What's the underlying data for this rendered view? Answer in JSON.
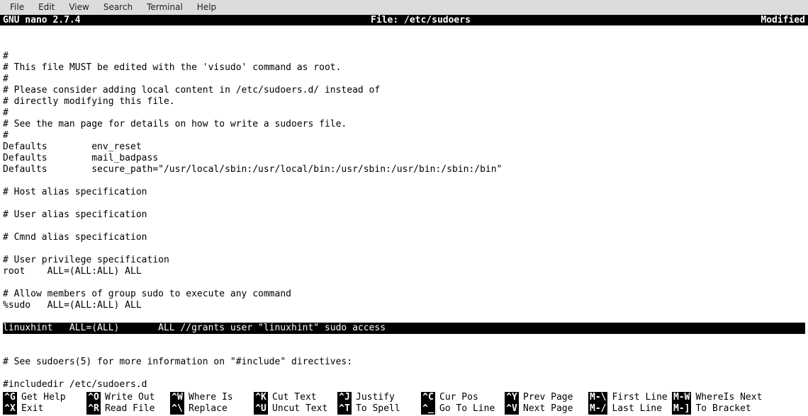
{
  "menubar": {
    "items": [
      "File",
      "Edit",
      "View",
      "Search",
      "Terminal",
      "Help"
    ]
  },
  "nano_title": {
    "app": "GNU nano 2.7.4",
    "file_label": "File: /etc/sudoers",
    "status": "Modified"
  },
  "content_lines": [
    "",
    "",
    "#",
    "# This file MUST be edited with the 'visudo' command as root.",
    "#",
    "# Please consider adding local content in /etc/sudoers.d/ instead of",
    "# directly modifying this file.",
    "#",
    "# See the man page for details on how to write a sudoers file.",
    "#",
    "Defaults        env_reset",
    "Defaults        mail_badpass",
    "Defaults        secure_path=\"/usr/local/sbin:/usr/local/bin:/usr/sbin:/usr/bin:/sbin:/bin\"",
    "",
    "# Host alias specification",
    "",
    "# User alias specification",
    "",
    "# Cmnd alias specification",
    "",
    "# User privilege specification",
    "root    ALL=(ALL:ALL) ALL",
    "",
    "# Allow members of group sudo to execute any command",
    "%sudo   ALL=(ALL:ALL) ALL",
    ""
  ],
  "cursor_line": "linuxhint   ALL=(ALL)       ALL //grants user \"linuxhint\" sudo access",
  "post_cursor_lines": [
    "",
    "",
    "# See sudoers(5) for more information on \"#include\" directives:",
    "",
    "#includedir /etc/sudoers.d",
    "",
    ""
  ],
  "shortcuts_row1": [
    {
      "key": "^G",
      "label": "Get Help"
    },
    {
      "key": "^O",
      "label": "Write Out"
    },
    {
      "key": "^W",
      "label": "Where Is"
    },
    {
      "key": "^K",
      "label": "Cut Text"
    },
    {
      "key": "^J",
      "label": "Justify"
    },
    {
      "key": "^C",
      "label": "Cur Pos"
    },
    {
      "key": "^Y",
      "label": "Prev Page"
    },
    {
      "key": "M-\\",
      "label": "First Line"
    },
    {
      "key": "M-W",
      "label": "WhereIs Next"
    }
  ],
  "shortcuts_row2": [
    {
      "key": "^X",
      "label": "Exit"
    },
    {
      "key": "^R",
      "label": "Read File"
    },
    {
      "key": "^\\",
      "label": "Replace"
    },
    {
      "key": "^U",
      "label": "Uncut Text"
    },
    {
      "key": "^T",
      "label": "To Spell"
    },
    {
      "key": "^_",
      "label": "Go To Line"
    },
    {
      "key": "^V",
      "label": "Next Page"
    },
    {
      "key": "M-/",
      "label": "Last Line"
    },
    {
      "key": "M-]",
      "label": "To Bracket"
    }
  ]
}
